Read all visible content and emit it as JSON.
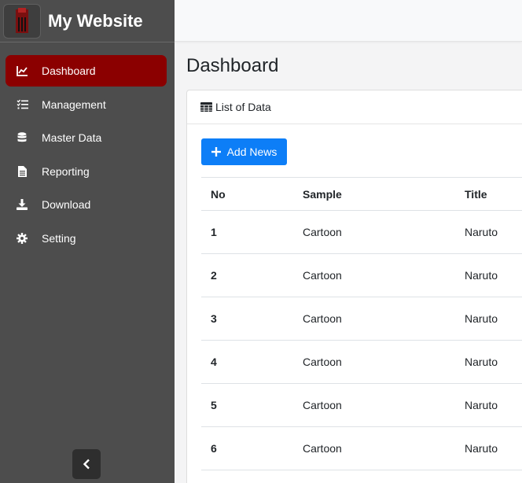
{
  "brand": {
    "title": "My Website"
  },
  "sidebar": {
    "items": [
      {
        "label": "Dashboard",
        "icon": "chart-line-icon",
        "active": true
      },
      {
        "label": "Management",
        "icon": "tasks-icon",
        "active": false
      },
      {
        "label": "Master Data",
        "icon": "database-icon",
        "active": false
      },
      {
        "label": "Reporting",
        "icon": "file-icon",
        "active": false
      },
      {
        "label": "Download",
        "icon": "download-icon",
        "active": false
      },
      {
        "label": "Setting",
        "icon": "gear-icon",
        "active": false
      }
    ],
    "collapse_icon": "chevron-left-icon"
  },
  "main": {
    "title": "Dashboard",
    "card_title": "List of Data",
    "add_button": "Add News",
    "table": {
      "columns": [
        "No",
        "Sample",
        "Title"
      ],
      "rows": [
        {
          "no": "1",
          "sample": "Cartoon",
          "title": "Naruto"
        },
        {
          "no": "2",
          "sample": "Cartoon",
          "title": "Naruto"
        },
        {
          "no": "3",
          "sample": "Cartoon",
          "title": "Naruto"
        },
        {
          "no": "4",
          "sample": "Cartoon",
          "title": "Naruto"
        },
        {
          "no": "5",
          "sample": "Cartoon",
          "title": "Naruto"
        },
        {
          "no": "6",
          "sample": "Cartoon",
          "title": "Naruto"
        }
      ]
    }
  },
  "colors": {
    "sidebar_bg": "#4d4d4d",
    "active_item": "#8b0000",
    "primary_button": "#0d7ef7"
  }
}
